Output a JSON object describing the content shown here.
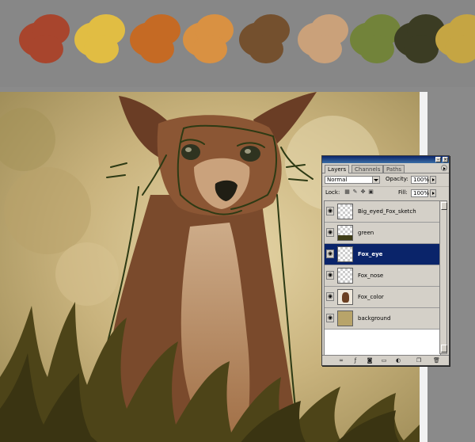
{
  "swatches": [
    {
      "name": "red",
      "color": "#a8452d"
    },
    {
      "name": "yellow",
      "color": "#e1bd43"
    },
    {
      "name": "orange",
      "color": "#c56a24"
    },
    {
      "name": "light-orange",
      "color": "#d99142"
    },
    {
      "name": "brown",
      "color": "#74502e"
    },
    {
      "name": "tan",
      "color": "#caa17a"
    },
    {
      "name": "green",
      "color": "#72833a"
    },
    {
      "name": "dark-olive",
      "color": "#3b3c23"
    },
    {
      "name": "khaki",
      "color": "#c5a543"
    }
  ],
  "layers_panel": {
    "tabs": [
      "Layers",
      "Channels",
      "Paths"
    ],
    "active_tab": "Layers",
    "blend_mode": "Normal",
    "opacity_label": "Opacity:",
    "opacity": "100%",
    "lock_label": "Lock:",
    "fill_label": "Fill:",
    "fill": "100%",
    "layers": [
      {
        "name": "Big_eyed_Fox_sketch",
        "selected": false
      },
      {
        "name": "green",
        "selected": false
      },
      {
        "name": "Fox_eye",
        "selected": true
      },
      {
        "name": "Fox_nose",
        "selected": false
      },
      {
        "name": "Fox_color",
        "selected": false
      },
      {
        "name": "background",
        "selected": false
      }
    ]
  },
  "colors": {
    "workspace": "#8a8a8a",
    "panel": "#d4d0c8",
    "selection": "#0a246a"
  }
}
